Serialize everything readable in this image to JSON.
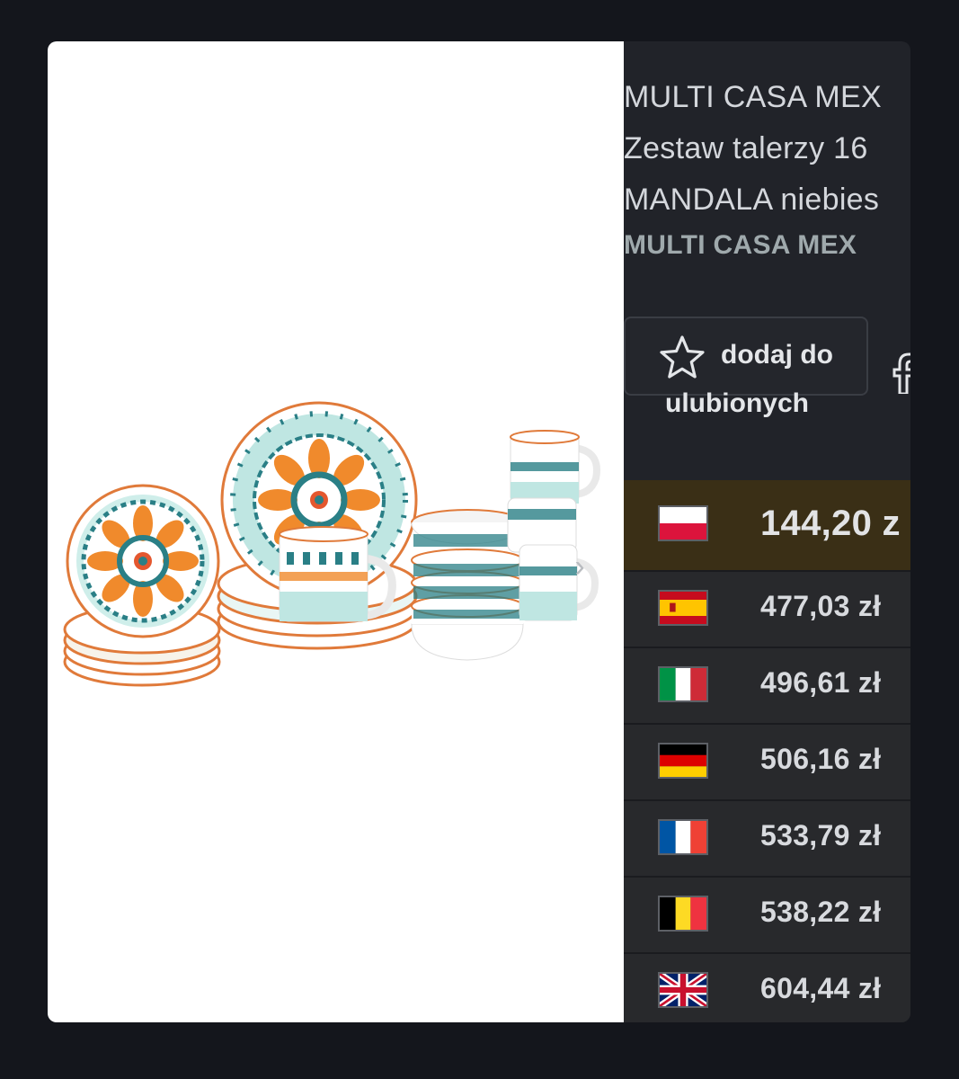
{
  "product": {
    "title_lines": [
      "MULTI CASA MEX",
      "Zestaw talerzy 16",
      "MANDALA niebies"
    ],
    "brand": "MULTI CASA MEX",
    "favorite_line1": "dodaj do",
    "favorite_line2": "ulubionych"
  },
  "prices": [
    {
      "country": "Poland",
      "flag_icon": "poland-flag-icon",
      "price": "144,20 z",
      "highlight": true
    },
    {
      "country": "Spain",
      "flag_icon": "spain-flag-icon",
      "price": "477,03 zł"
    },
    {
      "country": "Italy",
      "flag_icon": "italy-flag-icon",
      "price": "496,61 zł"
    },
    {
      "country": "Germany",
      "flag_icon": "germany-flag-icon",
      "price": "506,16 zł"
    },
    {
      "country": "France",
      "flag_icon": "france-flag-icon",
      "price": "533,79 zł"
    },
    {
      "country": "Belgium",
      "flag_icon": "belgium-flag-icon",
      "price": "538,22 zł"
    },
    {
      "country": "United Kingdom",
      "flag_icon": "uk-flag-icon",
      "price": "604,44 zł"
    }
  ],
  "colors": {
    "background": "#14161c",
    "card": "#212329",
    "highlight_row": "#3a2f16",
    "teal": "#2a7f86",
    "orange": "#f08a2c",
    "mint": "#bfe6e2"
  }
}
